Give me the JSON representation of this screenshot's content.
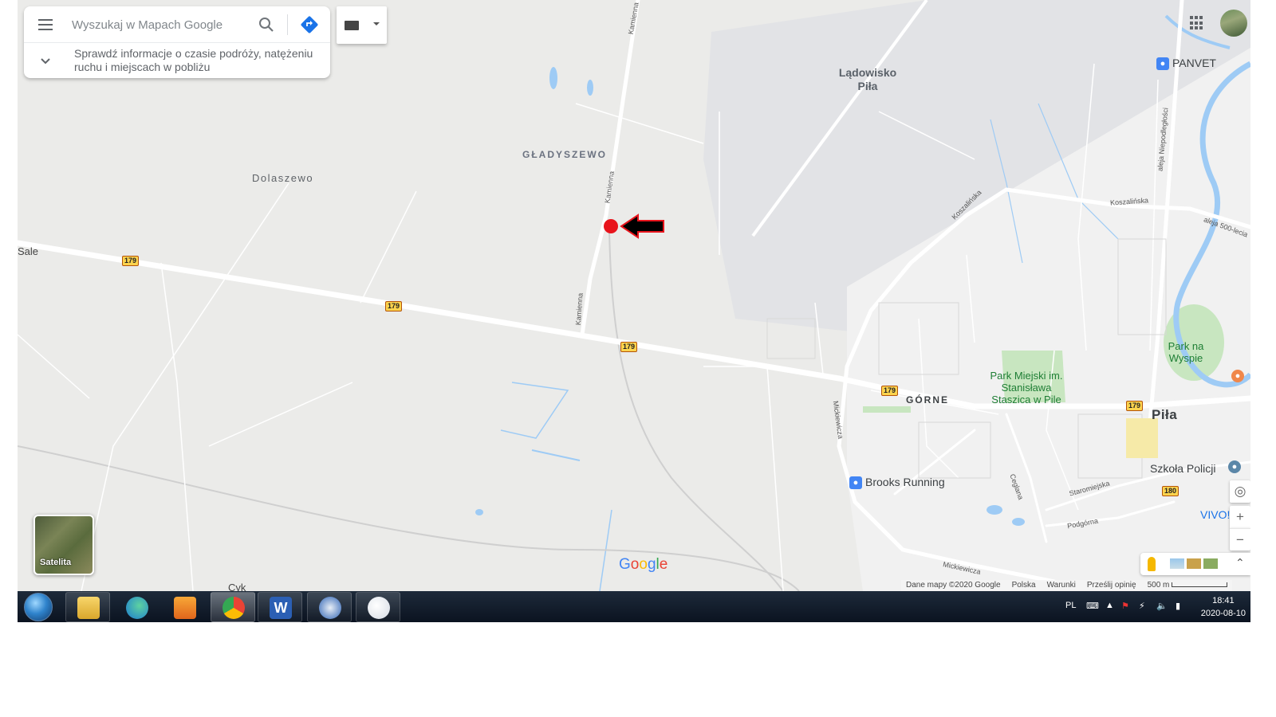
{
  "search": {
    "placeholder": "Wyszukaj w Mapach Google",
    "trip_info": "Sprawdź informacje o czasie podróży, natężeniu ruchu i miejscach w pobliżu"
  },
  "map": {
    "labels": {
      "ladowisko": "Lądowisko Piła",
      "gladyszewo": "GŁADYSZEWO",
      "dolaszewo": "Dolaszewo",
      "sale": "Sale",
      "gorne": "GÓRNE",
      "pila": "Piła",
      "park_miejski": "Park Miejski im. Stanisława Staszica w Pile",
      "park_wyspie": "Park na Wyspie",
      "panvet": "PANVET",
      "brooks": "Brooks Running",
      "szkola": "Szkoła Policji",
      "vivo": "VIVO!",
      "cyk": "Cyk",
      "kamienna_1": "Kamienna",
      "kamienna_2": "Kamienna",
      "kamienna_3": "Kamienna",
      "koszalinska_1": "Koszalińska",
      "koszalinska_2": "Koszalińska",
      "aleja_niepodleglosci": "aleja Niepodległości",
      "aleja_500": "aleja 500-lecia",
      "mickiewicza_1": "Mickiewicza",
      "mickiewicza_2": "Mickiewicza",
      "ceglana": "Ceglana",
      "staromiejska": "Staromiejska",
      "podgorna": "Podgórna"
    },
    "road_shields": [
      "179",
      "179",
      "179",
      "179",
      "179",
      "180"
    ]
  },
  "satellite": {
    "label": "Satelita"
  },
  "footer": {
    "data": "Dane mapy ©2020 Google",
    "country": "Polska",
    "terms": "Warunki",
    "feedback": "Prześlij opinię",
    "scale": "500 m"
  },
  "logo": {
    "text": "Google"
  },
  "taskbar": {
    "language": "PL",
    "time": "18:41",
    "date": "2020-08-10"
  },
  "colors": {
    "marker": "#e8141c",
    "arrow": "#000000",
    "road_shield": "#fcd34d",
    "poi_blue": "#4285f4",
    "park_green": "#c8e6c0"
  }
}
